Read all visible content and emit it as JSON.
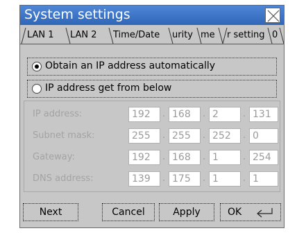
{
  "window": {
    "title": "System settings"
  },
  "tabs": [
    {
      "label": "LAN 1"
    },
    {
      "label": "LAN 2"
    },
    {
      "label": "Time/Date"
    },
    {
      "label": "urity"
    },
    {
      "label": "me"
    },
    {
      "label": "r setting"
    },
    {
      "label": "0"
    }
  ],
  "ip_mode": {
    "auto_label": "Obtain an IP address automatically",
    "manual_label": "IP address get from below",
    "selected": "auto"
  },
  "fields": [
    {
      "label": "IP address:",
      "octets": [
        "192",
        "168",
        "2",
        "131"
      ]
    },
    {
      "label": "Subnet mask:",
      "octets": [
        "255",
        "255",
        "252",
        "0"
      ]
    },
    {
      "label": "Gateway:",
      "octets": [
        "192",
        "168",
        "1",
        "254"
      ]
    },
    {
      "label": "DNS address:",
      "octets": [
        "139",
        "175",
        "1",
        "1"
      ]
    }
  ],
  "buttons": {
    "next": "Next",
    "cancel": "Cancel",
    "apply": "Apply",
    "ok": "OK"
  },
  "colors": {
    "title_bar": "#3c73c7",
    "window_bg": "#c7c7c7",
    "disabled_text": "#a3a3a3"
  },
  "icons": {
    "close": "close-icon",
    "enter": "enter-arrow-icon"
  }
}
